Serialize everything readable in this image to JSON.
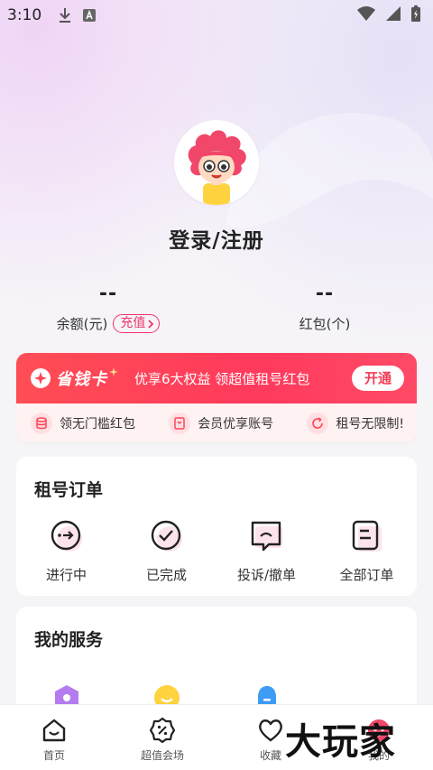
{
  "status_bar": {
    "time": "3:10"
  },
  "profile": {
    "login_text": "登录/注册"
  },
  "stats": {
    "balance": {
      "value": "--",
      "label": "余额(元)",
      "action": "充值"
    },
    "redpacket": {
      "value": "--",
      "label": "红包(个)"
    }
  },
  "vip_card": {
    "logo": "省钱卡",
    "description": "优享6大权益 领超值租号红包",
    "open_button": "开通",
    "benefits": [
      "领无门槛红包",
      "会员优享账号",
      "租号无限制!"
    ]
  },
  "orders": {
    "title": "租号订单",
    "items": [
      {
        "label": "进行中",
        "icon": "in-progress-icon"
      },
      {
        "label": "已完成",
        "icon": "check-circle-icon"
      },
      {
        "label": "投诉/撤单",
        "icon": "complaint-icon"
      },
      {
        "label": "全部订单",
        "icon": "all-orders-icon"
      }
    ]
  },
  "services": {
    "title": "我的服务",
    "icons": [
      "hexagon-icon",
      "smile-icon",
      "bell-icon"
    ]
  },
  "tabbar": {
    "tabs": [
      {
        "label": "首页",
        "icon": "home-icon"
      },
      {
        "label": "超值会场",
        "icon": "discount-icon"
      },
      {
        "label": "收藏",
        "icon": "heart-icon"
      },
      {
        "label": "我的",
        "icon": "profile-icon"
      }
    ]
  },
  "watermark": "大玩家",
  "colors": {
    "accent": "#f0346a",
    "vip_red": "#ff4458",
    "text": "#222222"
  }
}
